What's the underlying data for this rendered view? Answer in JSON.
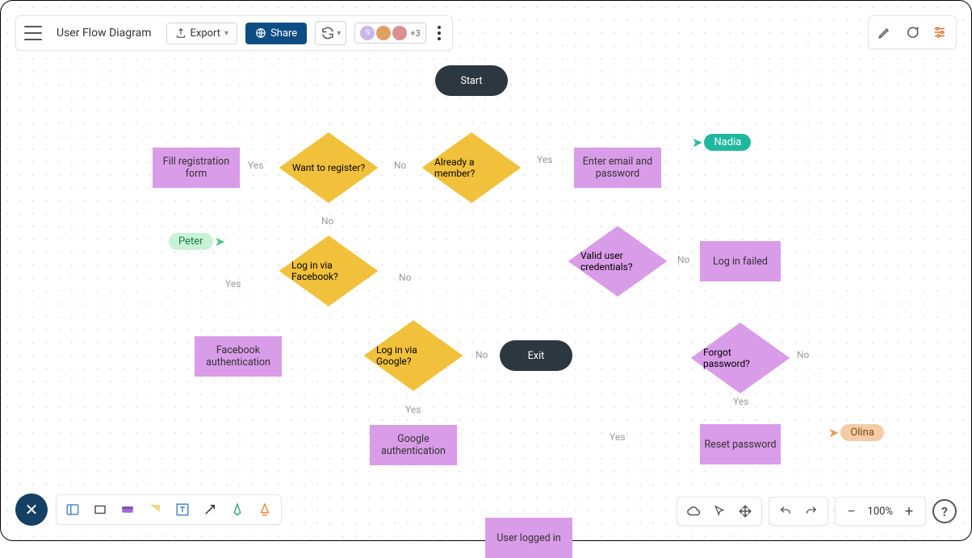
{
  "toolbar": {
    "doc_title": "User Flow Diagram",
    "export_label": "Export",
    "share_label": "Share",
    "plus_count": "+3"
  },
  "nodes": {
    "start": "Start",
    "already_member": "Already a member?",
    "want_register": "Want to register?",
    "fill_registration": "Fill registration form",
    "login_facebook": "Log in via Facebook?",
    "login_google": "Log in via Google?",
    "facebook_auth": "Facebook authentication",
    "google_auth": "Google authentication",
    "exit": "Exit",
    "enter_email": "Enter email and password",
    "valid_creds": "Valid user credentials?",
    "login_failed": "Log in failed",
    "forgot_pw": "Forgot password?",
    "reset_pw": "Reset password",
    "user_logged_in": "User logged in"
  },
  "labels": {
    "yes": "Yes",
    "no": "No"
  },
  "collaborators": {
    "peter": "Peter",
    "nadia": "Nadia",
    "olina": "Olina"
  },
  "zoom": {
    "level": "100%"
  }
}
